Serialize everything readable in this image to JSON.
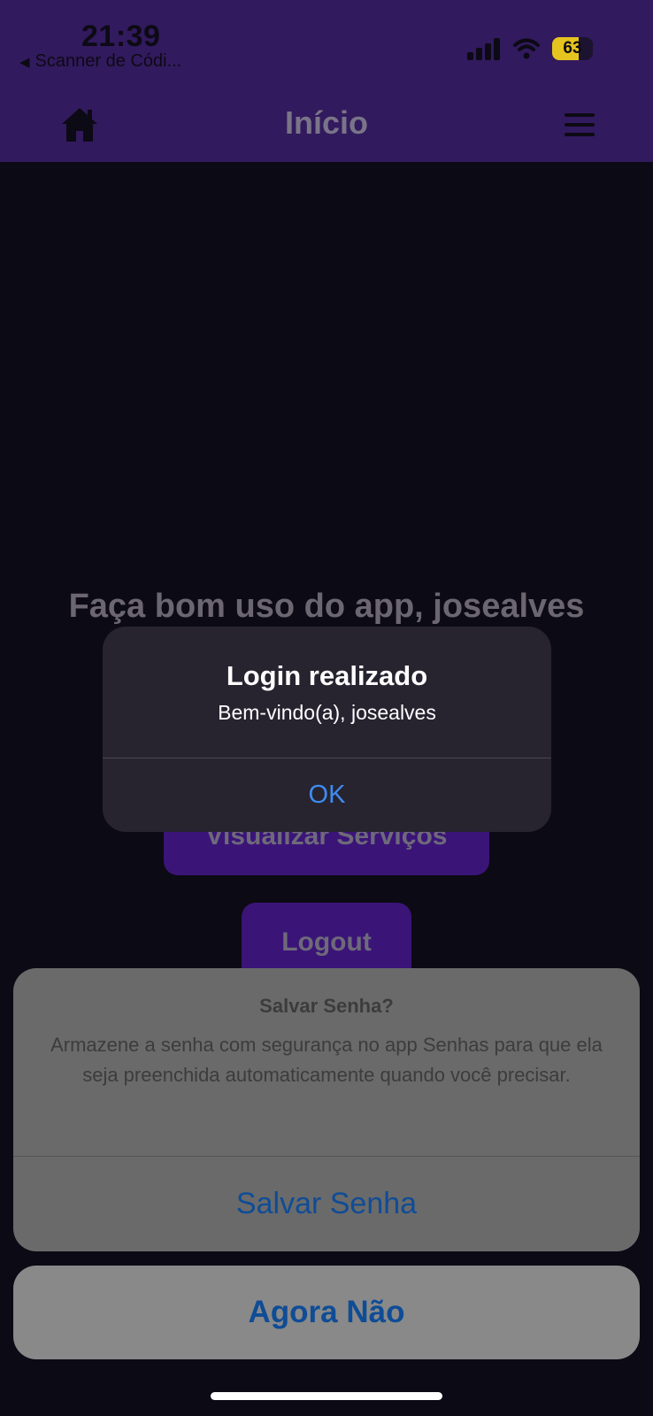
{
  "status_bar": {
    "time": "21:39",
    "back_app": "Scanner de Códi...",
    "battery_percent": "63",
    "icons": [
      "cellular-signal-icon",
      "wifi-icon",
      "battery-icon"
    ]
  },
  "header": {
    "title": "Início",
    "left_icon": "home-icon",
    "right_icon": "hamburger-menu-icon",
    "background_color": "#321a5e"
  },
  "main": {
    "welcome_text": "Faça bom uso do app, josealves",
    "services_button": "Visualizar Serviços",
    "logout_button": "Logout"
  },
  "alert": {
    "title": "Login realizado",
    "message": "Bem-vindo(a), josealves",
    "ok_label": "OK"
  },
  "password_sheet": {
    "title": "Salvar Senha?",
    "message": "Armazene a senha com segurança no app Senhas para que ela seja preenchida automaticamente quando você precisar.",
    "save_label": "Salvar Senha",
    "cancel_label": "Agora Não"
  },
  "colors": {
    "accent_blue": "#3f8cf0",
    "sheet_action_blue": "#0f4c96",
    "battery_yellow": "#e6c420"
  }
}
